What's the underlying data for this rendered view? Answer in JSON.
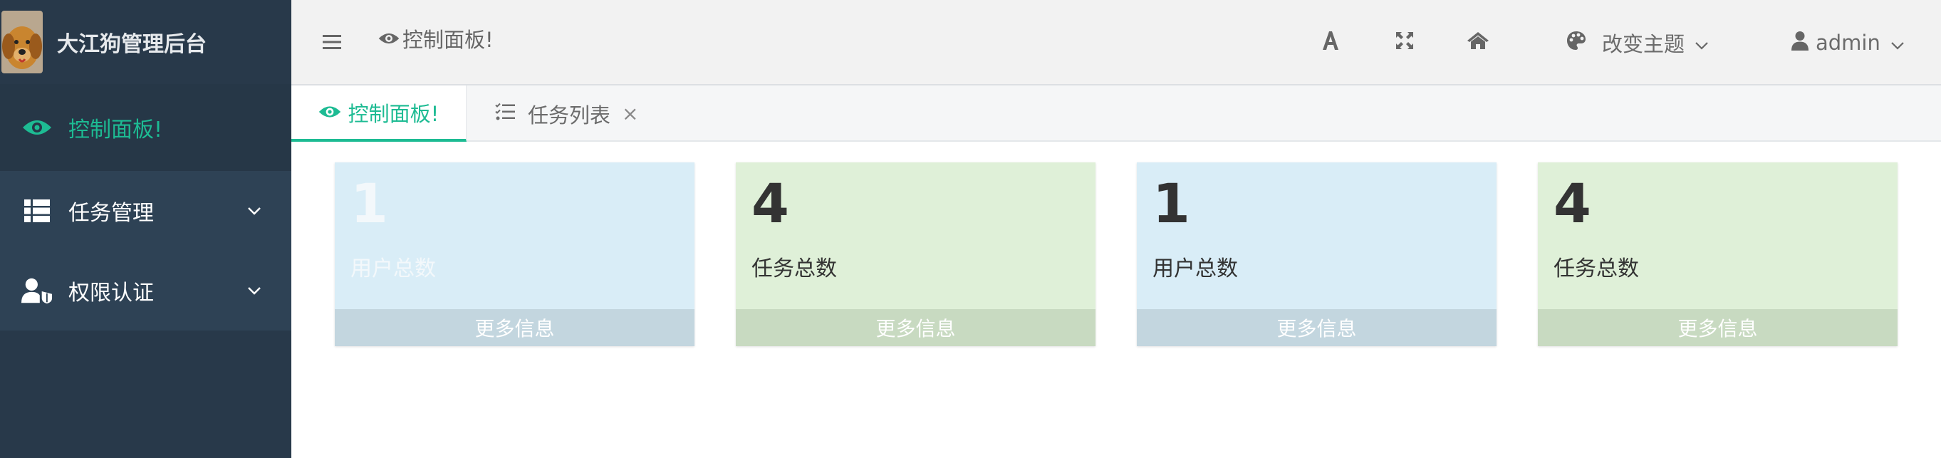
{
  "sidebar": {
    "brand_title": "大江狗管理后台",
    "items": [
      {
        "label": "控制面板!",
        "icon": "eye-icon",
        "active": true
      },
      {
        "label": "任务管理",
        "icon": "list-icon"
      },
      {
        "label": "权限认证",
        "icon": "user-shield-icon"
      }
    ]
  },
  "header": {
    "breadcrumb": "控制面板!",
    "theme_label": "改变主题",
    "user_label": "admin"
  },
  "tabs": [
    {
      "label": "控制面板!",
      "active": true
    },
    {
      "label": "任务列表",
      "closable": true
    }
  ],
  "cards": [
    {
      "value": "1",
      "label": "用户总数",
      "more": "更多信息",
      "color": "blue"
    },
    {
      "value": "4",
      "label": "任务总数",
      "more": "更多信息",
      "color": "green"
    },
    {
      "value": "1",
      "label": "用户总数",
      "more": "更多信息",
      "color": "blue"
    },
    {
      "value": "4",
      "label": "任务总数",
      "more": "更多信息",
      "color": "green"
    }
  ],
  "colors": {
    "sidebar_bg": "#28394a",
    "accent": "#1dbb93",
    "header_bg": "#f2f2f2",
    "card_blue": "#d9edf7",
    "card_green": "#dff0d8"
  }
}
